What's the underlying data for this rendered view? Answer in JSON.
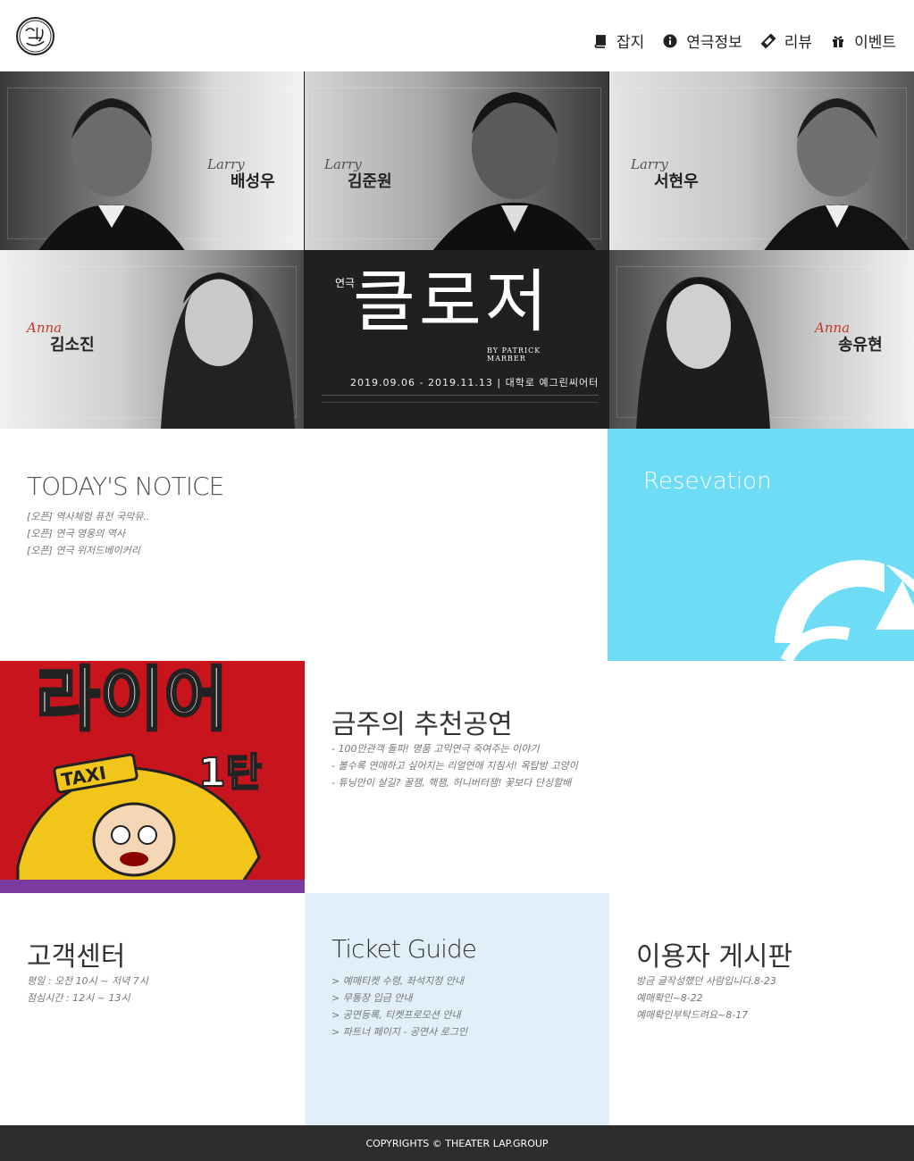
{
  "header": {
    "logo_alt": "theater logo",
    "nav": [
      {
        "label": "잡지",
        "icon": "book-icon"
      },
      {
        "label": "연극정보",
        "icon": "info-icon"
      },
      {
        "label": "리뷰",
        "icon": "ticket-icon"
      },
      {
        "label": "이벤트",
        "icon": "gift-icon"
      }
    ]
  },
  "hero": {
    "cast": [
      {
        "role": "Larry",
        "name": "배성우"
      },
      {
        "role": "Larry",
        "name": "김준원"
      },
      {
        "role": "Larry",
        "name": "서현우"
      },
      {
        "role": "Anna",
        "name": "김소진"
      },
      {
        "role": "Anna",
        "name": "송유현"
      }
    ],
    "poster_prefix": "연극",
    "poster_title": "클로저",
    "poster_by": "BY PATRICK MARBER",
    "poster_dates": "2019.09.06 - 2019.11.13  |  대학로 예그린씨어터"
  },
  "notice": {
    "title": "TODAY'S NOTICE",
    "items": [
      "[오픈] 역사체험 퓨전 국악뮤..",
      "[오픈] 연극 영웅의 역사",
      "[오픈] 연극 위저드베이커리"
    ]
  },
  "reservation": {
    "title": "Resevation"
  },
  "recommend": {
    "title": "금주의 추천공연",
    "items": [
      "- 100만관객 돌파! 명품 고믹연극 죽여주는 이야기",
      "- 볼수록 연애하고 싶어지는 리얼연애 지침서! 옥탑방 고양이",
      "- 튜닝만이 살길? 꿀잼, 핵잼, 허니버터잼! 꽃보다 단싱할배"
    ],
    "poster_text": "라이어",
    "poster_sub": "1탄",
    "poster_taxi": "TAXI"
  },
  "customer": {
    "title": "고객센터",
    "items": [
      "평일 : 오전 10시 ~ 저녁 7시",
      "점심시간 : 12시 ~ 13시"
    ]
  },
  "ticket_guide": {
    "title": "Ticket Guide",
    "items": [
      "> 예매티켓 수령, 좌석지정 안내",
      "> 무통장 입금 안내",
      "> 공연등록, 티켓프로모션 안내",
      "> 파트너 페이지 - 공연사 로그인"
    ]
  },
  "board": {
    "title": "이용자 게시판",
    "items": [
      "방금 글작성했던 사람입니다.8-23",
      "예매확인~8-22",
      "예매확인부탁드려요~8-17"
    ]
  },
  "footer": {
    "text": "COPYRIGHTS © THEATER LAP.GROUP"
  },
  "colors": {
    "reservation_bg": "#6fdcf6",
    "guide_bg": "#e1eff9",
    "footer_bg": "#2d2d2d",
    "poster_red": "#c8151d"
  }
}
